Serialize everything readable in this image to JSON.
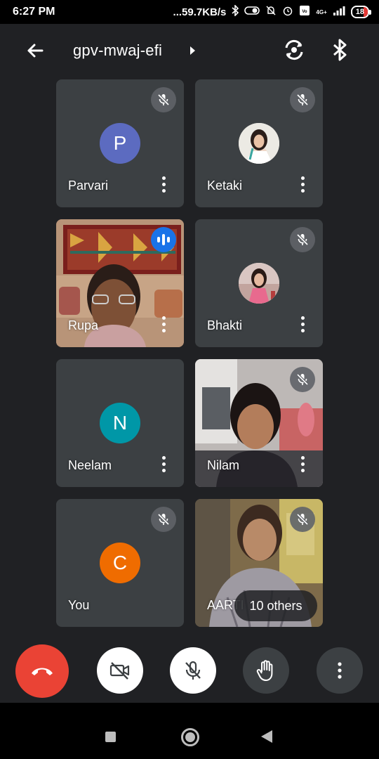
{
  "status_bar": {
    "time": "6:27 PM",
    "network_speed": "...59.7KB/s",
    "network_type": "4G+",
    "battery": "18"
  },
  "meeting": {
    "code": "gpv-mwaj-efi"
  },
  "participants": [
    {
      "name": "Parvari",
      "initial": "P",
      "avatar_color": "#5c6bc0",
      "muted": true
    },
    {
      "name": "Ketaki",
      "muted": true
    },
    {
      "name": "Rupa",
      "speaking": true
    },
    {
      "name": "Bhakti",
      "muted": true
    },
    {
      "name": "Neelam",
      "initial": "N",
      "avatar_color": "#0097a7"
    },
    {
      "name": "Nilam",
      "muted": true
    },
    {
      "name": "You",
      "initial": "C",
      "avatar_color": "#ef6c00",
      "muted": true
    },
    {
      "name": "AARTI",
      "muted": true
    }
  ],
  "others_label": "10 others",
  "controls": {
    "end_call_color": "#ea4335",
    "items": [
      "end-call",
      "camera-off",
      "mic-off",
      "raise-hand",
      "more-options"
    ]
  }
}
